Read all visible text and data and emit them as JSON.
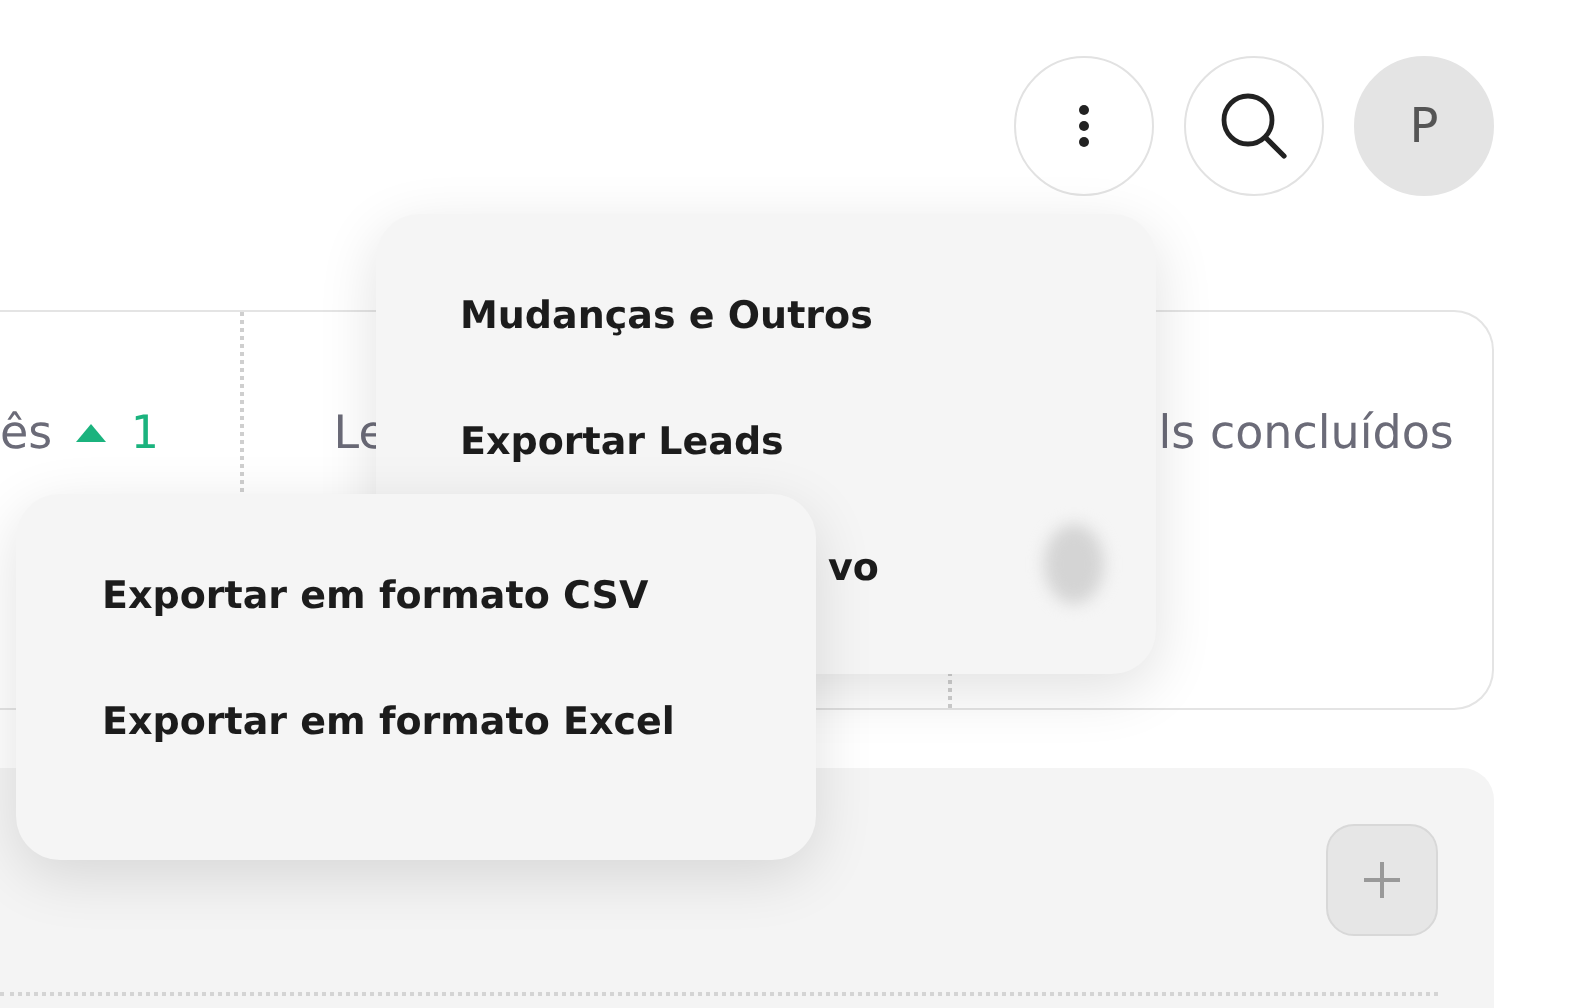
{
  "header": {
    "avatar_initial": "P"
  },
  "stats": [
    {
      "label": "ês",
      "trend": "1"
    },
    {
      "label": "Le"
    },
    {
      "label": "ls concluídos"
    }
  ],
  "menu": {
    "items": [
      "Mudanças e Outros",
      "Exportar Leads",
      "vo"
    ]
  },
  "submenu": {
    "items": [
      "Exportar em formato CSV",
      "Exportar em formato Excel"
    ]
  }
}
